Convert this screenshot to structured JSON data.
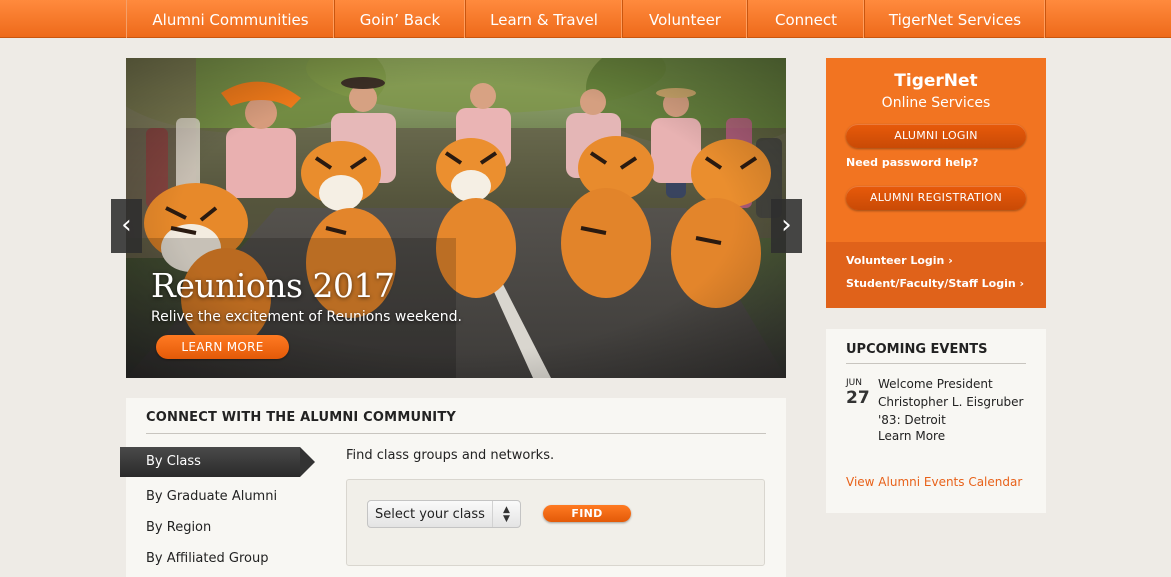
{
  "nav": {
    "items": [
      {
        "label": "Alumni Communities",
        "width": 208
      },
      {
        "label": "Goin’ Back",
        "width": 131
      },
      {
        "label": "Learn & Travel",
        "width": 157
      },
      {
        "label": "Volunteer",
        "width": 125
      },
      {
        "label": "Connect",
        "width": 117
      },
      {
        "label": "TigerNet Services",
        "width": 181
      }
    ]
  },
  "hero": {
    "title": "Reunions 2017",
    "subtitle": "Relive the excitement of Reunions weekend.",
    "button": "LEARN MORE",
    "prev_icon": "‹",
    "next_icon": "›"
  },
  "connect": {
    "title": "CONNECT WITH THE ALUMNI COMMUNITY",
    "tabs": [
      "By Class",
      "By Graduate Alumni",
      "By Region",
      "By Affiliated Group"
    ],
    "description": "Find class groups and networks.",
    "select_label": "Select your class",
    "find_button": "FIND"
  },
  "tigernet": {
    "title": "TigerNet",
    "subtitle": "Online Services",
    "login_button": "ALUMNI LOGIN",
    "password_help": "Need password help?",
    "register_button": "ALUMNI REGISTRATION",
    "volunteer_login": "Volunteer Login ›",
    "staff_login": "Student/Faculty/Staff Login ›"
  },
  "events": {
    "title": "UPCOMING EVENTS",
    "items": [
      {
        "month": "JUN",
        "day": "27",
        "name": "Welcome President Christopher L. Eisgruber '83: Detroit",
        "more": "Learn More"
      }
    ],
    "calendar_link": "View Alumni Events Calendar"
  },
  "colors": {
    "accent": "#f27421",
    "nav": "#f57b2c",
    "background": "#eeebe6",
    "panel": "#f8f7f3"
  }
}
